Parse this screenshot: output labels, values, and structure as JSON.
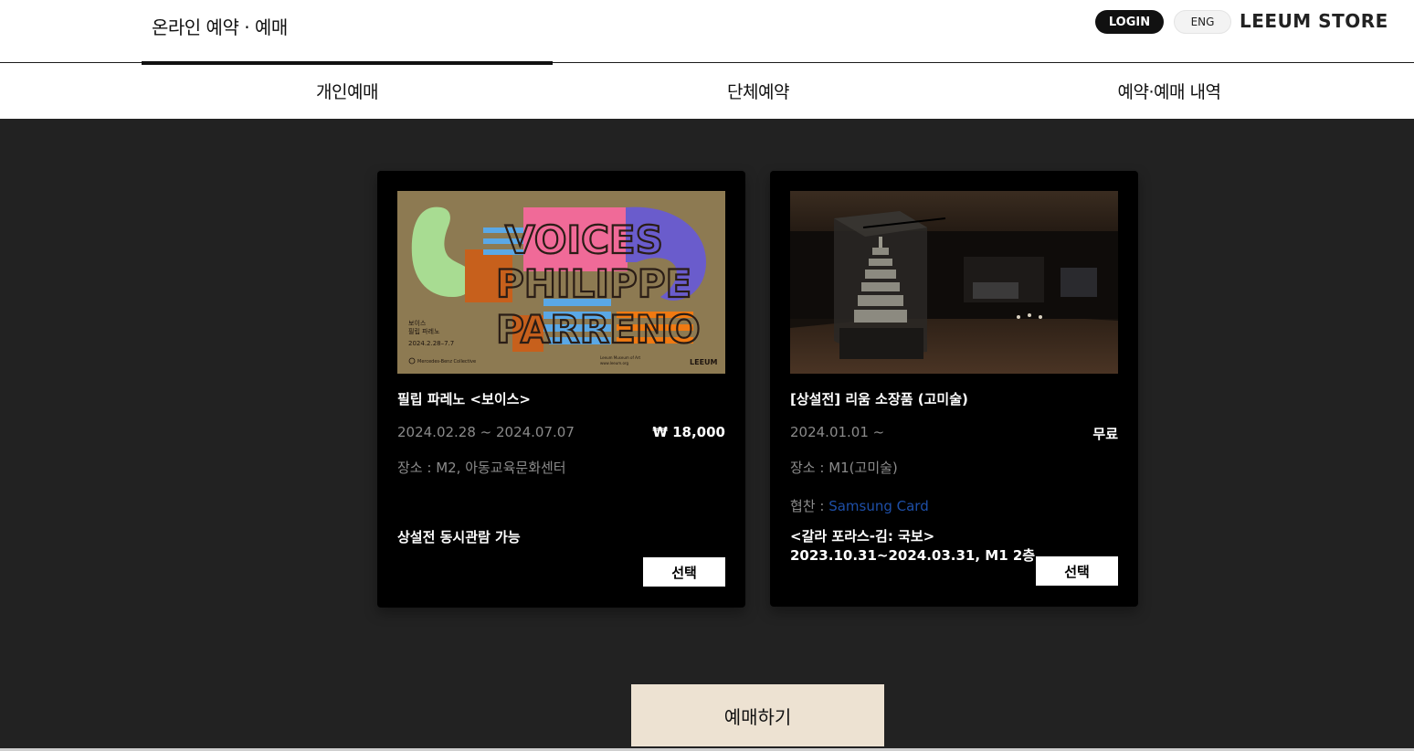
{
  "header": {
    "title": "온라인 예약 · 예매",
    "login_label": "LOGIN",
    "lang_label": "ENG",
    "store_label": "LEEUM STORE"
  },
  "tabs": [
    {
      "label": "개인예매",
      "active": true
    },
    {
      "label": "단체예약",
      "active": false
    },
    {
      "label": "예약·예매 내역",
      "active": false
    }
  ],
  "cards": [
    {
      "title": "필립 파레노 <보이스>",
      "date": "2024.02.28 ~ 2024.07.07",
      "price": "₩ 18,000",
      "venue": "장소 : M2, 아동교육문화센터",
      "note": "상설전 동시관람 가능",
      "button_label": "선택",
      "poster": {
        "title_lines": [
          "VOICES",
          "PHILIPPE",
          "PARRENO"
        ],
        "kr_lines": [
          "보이스",
          "필립 파레노",
          "2024.2.28–7.7"
        ],
        "sponsor": "Mercedes-Benz Collective",
        "museum_lines": [
          "Leeum Museum of Art",
          "www.leeum.org"
        ],
        "logo": "LEEUM"
      }
    },
    {
      "title": "[상설전] 리움 소장품 (고미술)",
      "date": "2024.01.01 ~",
      "price": "무료",
      "venue": "장소 : M1(고미술)",
      "sponsor_prefix": "협찬 : ",
      "sponsor_name": "Samsung Card",
      "note_lines": [
        "<갈라 포라스-김: 국보>",
        "2023.10.31~2024.03.31, M1 2층"
      ],
      "button_label": "선택"
    }
  ],
  "cta": {
    "label": "예매하기"
  },
  "colors": {
    "accent_beige": "#ede2d2",
    "background": "#222222",
    "card": "#000000",
    "sponsor_blue": "#1e4fa8",
    "poster_bg": "#8d7a52"
  }
}
